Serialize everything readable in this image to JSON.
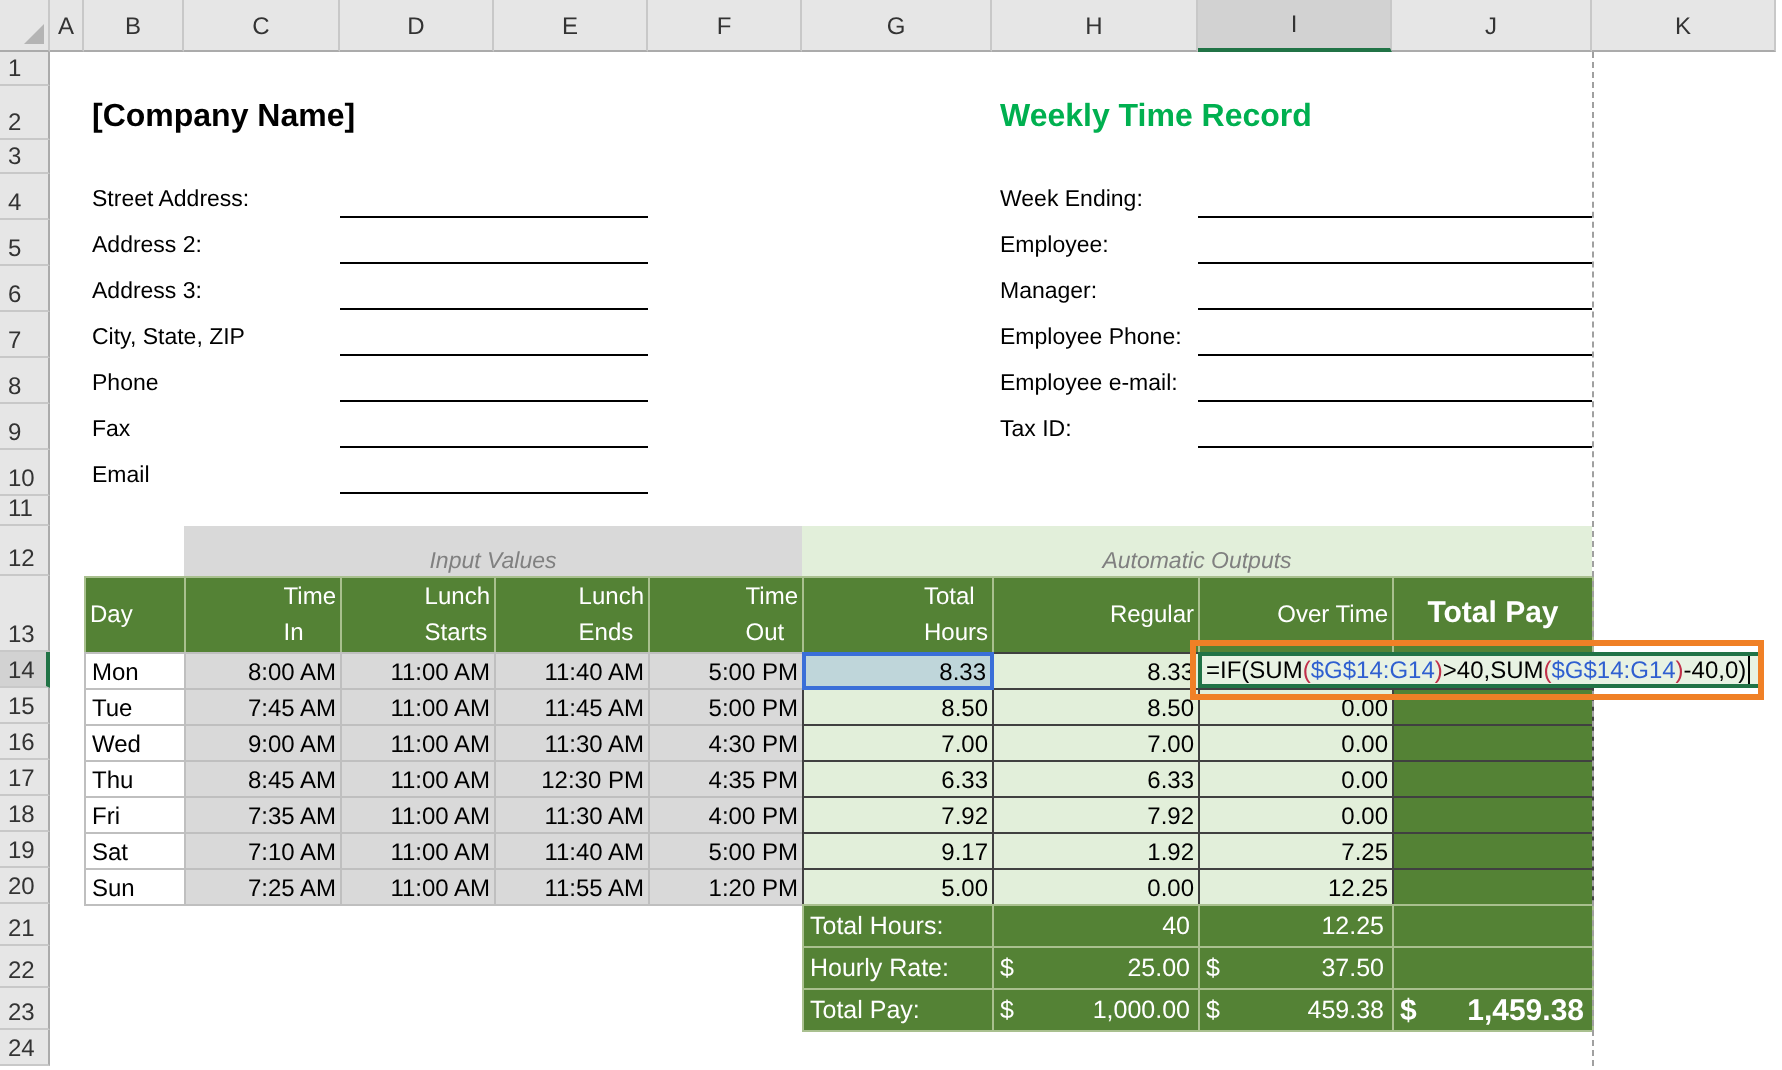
{
  "column_headers": [
    {
      "label": "A",
      "selected": false
    },
    {
      "label": "B",
      "selected": false
    },
    {
      "label": "C",
      "selected": false
    },
    {
      "label": "D",
      "selected": false
    },
    {
      "label": "E",
      "selected": false
    },
    {
      "label": "F",
      "selected": false
    },
    {
      "label": "G",
      "selected": false
    },
    {
      "label": "H",
      "selected": false
    },
    {
      "label": "I",
      "selected": true
    },
    {
      "label": "J",
      "selected": false
    },
    {
      "label": "K",
      "selected": false
    }
  ],
  "row_headers": [
    {
      "label": "1",
      "selected": false
    },
    {
      "label": "2",
      "selected": false
    },
    {
      "label": "3",
      "selected": false
    },
    {
      "label": "4",
      "selected": false
    },
    {
      "label": "5",
      "selected": false
    },
    {
      "label": "6",
      "selected": false
    },
    {
      "label": "7",
      "selected": false
    },
    {
      "label": "8",
      "selected": false
    },
    {
      "label": "9",
      "selected": false
    },
    {
      "label": "10",
      "selected": false
    },
    {
      "label": "11",
      "selected": false
    },
    {
      "label": "12",
      "selected": false
    },
    {
      "label": "13",
      "selected": false
    },
    {
      "label": "14",
      "selected": true
    },
    {
      "label": "15",
      "selected": false
    },
    {
      "label": "16",
      "selected": false
    },
    {
      "label": "17",
      "selected": false
    },
    {
      "label": "18",
      "selected": false
    },
    {
      "label": "19",
      "selected": false
    },
    {
      "label": "20",
      "selected": false
    },
    {
      "label": "21",
      "selected": false
    },
    {
      "label": "22",
      "selected": false
    },
    {
      "label": "23",
      "selected": false
    },
    {
      "label": "24",
      "selected": false
    }
  ],
  "company_name": "[Company Name]",
  "title": "Weekly Time Record",
  "left_fields": [
    "Street Address:",
    "Address 2:",
    "Address 3:",
    "City, State, ZIP",
    "Phone",
    "Fax",
    "Email"
  ],
  "right_fields": [
    "Week Ending:",
    "Employee:",
    "Manager:",
    "Employee Phone:",
    "Employee e-mail:",
    "Tax ID:"
  ],
  "input_values_label": "Input Values",
  "automatic_outputs_label": "Automatic Outputs",
  "columns": [
    {
      "lines": [
        "Day"
      ],
      "kind": "day"
    },
    {
      "lines": [
        "Time",
        "In"
      ],
      "kind": "time"
    },
    {
      "lines": [
        "Lunch",
        "Starts"
      ],
      "kind": "time"
    },
    {
      "lines": [
        "Lunch",
        "Ends"
      ],
      "kind": "time"
    },
    {
      "lines": [
        "Time",
        "Out"
      ],
      "kind": "time"
    },
    {
      "lines": [
        "Total",
        "Hours"
      ],
      "kind": "hours"
    },
    {
      "lines": [
        "Regular"
      ],
      "kind": "hours"
    },
    {
      "lines": [
        "Over Time"
      ],
      "kind": "hours"
    },
    {
      "lines": [
        "Total Pay"
      ],
      "kind": "total"
    }
  ],
  "rows": [
    {
      "cells": [
        "Mon",
        "8:00 AM",
        "11:00 AM",
        "11:40 AM",
        "5:00 PM",
        "8.33",
        "8.33"
      ],
      "referenced": true
    },
    {
      "cells": [
        "Tue",
        "7:45 AM",
        "11:00 AM",
        "11:45 AM",
        "5:00 PM",
        "8.50",
        "8.50",
        "0.00"
      ],
      "referenced": false
    },
    {
      "cells": [
        "Wed",
        "9:00 AM",
        "11:00 AM",
        "11:30 AM",
        "4:30 PM",
        "7.00",
        "7.00",
        "0.00"
      ],
      "referenced": false
    },
    {
      "cells": [
        "Thu",
        "8:45 AM",
        "11:00 AM",
        "12:30 PM",
        "4:35 PM",
        "6.33",
        "6.33",
        "0.00"
      ],
      "referenced": false
    },
    {
      "cells": [
        "Fri",
        "7:35 AM",
        "11:00 AM",
        "11:30 AM",
        "4:00 PM",
        "7.92",
        "7.92",
        "0.00"
      ],
      "referenced": false
    },
    {
      "cells": [
        "Sat",
        "7:10 AM",
        "11:00 AM",
        "11:40 AM",
        "5:00 PM",
        "9.17",
        "1.92",
        "7.25"
      ],
      "referenced": false
    },
    {
      "cells": [
        "Sun",
        "7:25 AM",
        "11:00 AM",
        "11:55 AM",
        "1:20 PM",
        "5.00",
        "0.00",
        "12.25"
      ],
      "referenced": false
    }
  ],
  "totals": [
    {
      "label": "Total Hours:",
      "cells": [
        {
          "amount": "40"
        },
        {
          "amount": "12.25"
        }
      ]
    },
    {
      "label": "Hourly Rate:",
      "cells": [
        {
          "currency": "$",
          "amount": "25.00"
        },
        {
          "currency": "$",
          "amount": "37.50"
        }
      ]
    },
    {
      "label": "Total Pay:",
      "cells": [
        {
          "currency": "$",
          "amount": "1,000.00"
        },
        {
          "currency": "$",
          "amount": "459.38"
        },
        {
          "currency": "$",
          "amount": "1,459.38",
          "kind": "grand"
        }
      ]
    }
  ],
  "editor": {
    "parts": [
      {
        "text": "=IF(SUM",
        "color": "#000000"
      },
      {
        "text": "(",
        "color": "#c0304a"
      },
      {
        "text": "$G$14:G14",
        "color": "#2f5fd0"
      },
      {
        "text": ")",
        "color": "#c0304a"
      },
      {
        "text": ">40,SUM",
        "color": "#000000"
      },
      {
        "text": "(",
        "color": "#c0304a"
      },
      {
        "text": "$G$14:G14",
        "color": "#2f5fd0"
      },
      {
        "text": ")",
        "color": "#c0304a"
      },
      {
        "text": "-40,0)",
        "color": "#000000"
      }
    ]
  }
}
